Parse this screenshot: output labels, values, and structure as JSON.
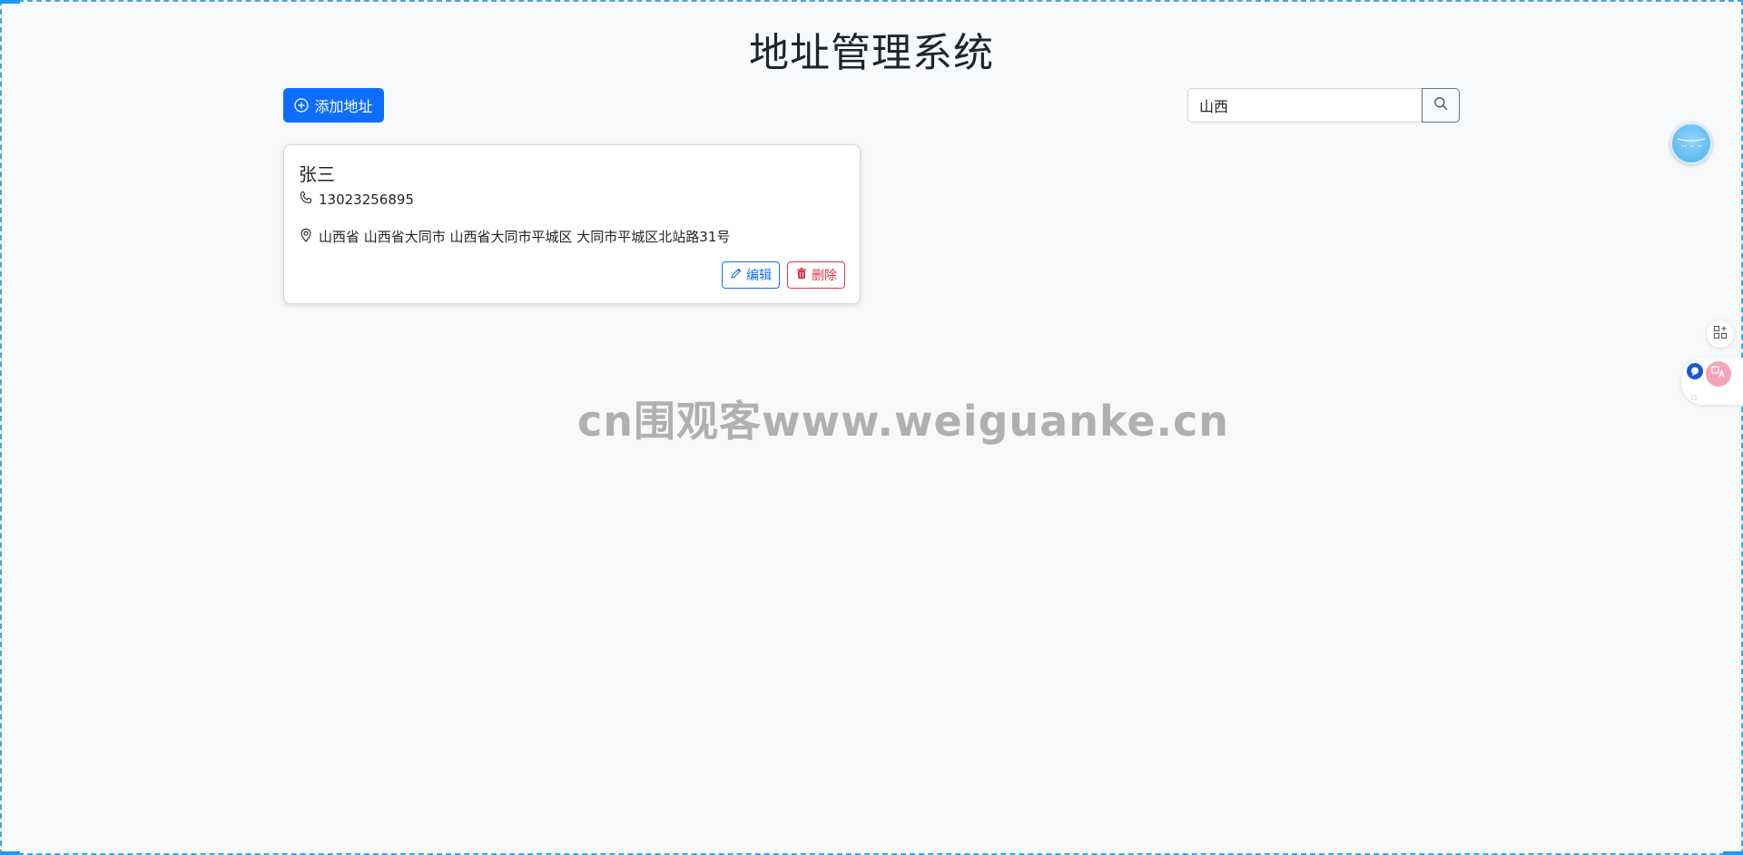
{
  "page": {
    "title": "地址管理系统"
  },
  "toolbar": {
    "add_label": "添加地址",
    "search_value": "山西"
  },
  "addresses": [
    {
      "name": "张三",
      "phone": "13023256895",
      "address": "山西省 山西省大同市 山西省大同市平城区 大同市平城区北站路31号",
      "edit_label": "编辑",
      "delete_label": "删除"
    }
  ],
  "watermark": "cn围观客www.weiguanke.cn",
  "colors": {
    "primary": "#0d6efd",
    "danger": "#dc3545",
    "background": "#f8f9fa"
  }
}
